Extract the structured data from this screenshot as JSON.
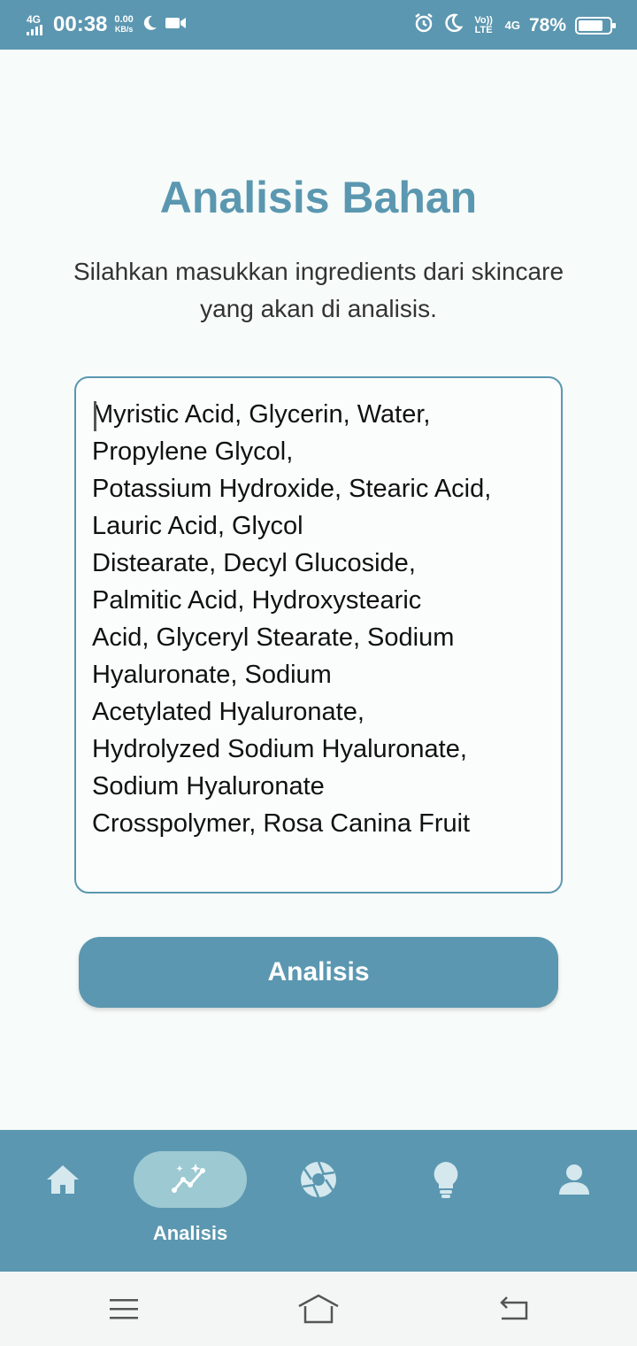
{
  "status_bar": {
    "network": "4G",
    "time": "00:38",
    "speed_value": "0.00",
    "speed_unit": "KB/s",
    "volte": "Vo)) LTE",
    "network_right": "4G",
    "battery": "78%",
    "battery_level": 0.78,
    "icons": [
      "signal-icon",
      "moon-icon",
      "video-icon",
      "alarm-icon",
      "moon-icon",
      "battery-icon"
    ]
  },
  "main": {
    "title": "Analisis Bahan",
    "subtitle": "Silahkan masukkan ingredients dari skincare yang akan di analisis.",
    "ingredients_value": "Myristic Acid, Glycerin, Water,\nPropylene Glycol,\nPotassium Hydroxide, Stearic Acid,\nLauric Acid, Glycol\nDistearate, Decyl Glucoside,\nPalmitic Acid, Hydroxystearic\nAcid, Glyceryl Stearate, Sodium\nHyaluronate, Sodium\nAcetylated Hyaluronate,\nHydrolyzed Sodium Hyaluronate,\nSodium Hyaluronate\nCrosspolymer, Rosa Canina Fruit",
    "analyze_button": "Analisis"
  },
  "bottom_nav": {
    "items": [
      {
        "icon": "home-icon",
        "label": ""
      },
      {
        "icon": "analysis-icon",
        "label": "Analisis",
        "active": true
      },
      {
        "icon": "camera-shutter-icon",
        "label": ""
      },
      {
        "icon": "lightbulb-icon",
        "label": ""
      },
      {
        "icon": "profile-icon",
        "label": ""
      }
    ]
  },
  "system_nav": {
    "icons": [
      "menu-icon",
      "home-outline-icon",
      "back-icon"
    ]
  },
  "colors": {
    "accent": "#5b97b0",
    "active_pill": "#9cc9d2",
    "background": "#f7fbf9",
    "icon_muted": "#d4e8ee"
  }
}
